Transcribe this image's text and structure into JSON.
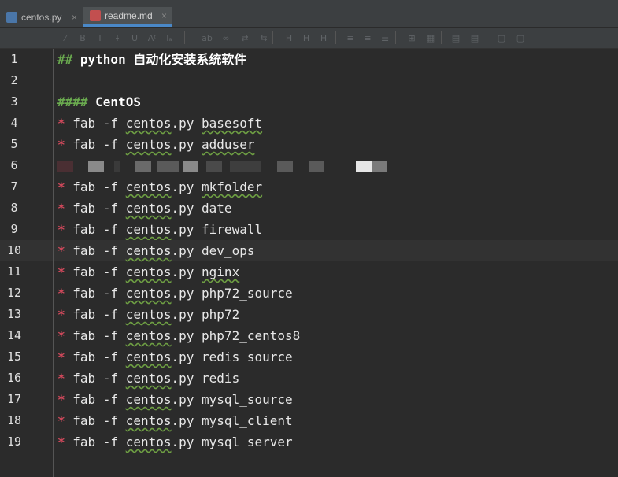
{
  "tabs": [
    {
      "label": "centos.py",
      "close": "×",
      "icon_color": "#4a76a8"
    },
    {
      "label": "readme.md",
      "close": "×",
      "icon_color": "#c24f4f"
    }
  ],
  "toolbar_icons": [
    "format-icon",
    "bold-icon",
    "italic-icon",
    "strikethrough-icon",
    "underline-icon",
    "superscript-icon",
    "subscript-icon",
    "code-icon",
    "link-icon",
    "image-icon",
    "quote-icon",
    "header-icon",
    "header2-icon",
    "header3-icon",
    "align-left-icon",
    "align-center-icon",
    "list-icon",
    "table-icon",
    "grid-icon",
    "preview-icon",
    "split-icon",
    "export-icon",
    "copy-icon"
  ],
  "toolbar_glyphs": [
    "⁄",
    "B",
    "I",
    "Ŧ",
    "U",
    "Aᶦ",
    "Iₐ",
    "ab",
    "∞",
    "⇄",
    "⇆",
    "H",
    "H",
    "H",
    "≡",
    "≡",
    "☰",
    "⊞",
    "▦",
    "▤",
    "▤",
    "▢",
    "▢"
  ],
  "lines": [
    {
      "n": "1",
      "type": "h2",
      "mark": "##",
      "text": " python 自动化安装系统软件"
    },
    {
      "n": "2",
      "type": "blank"
    },
    {
      "n": "3",
      "type": "h4",
      "mark": "####",
      "text": " CentOS"
    },
    {
      "n": "4",
      "type": "cmd",
      "bullet": "*",
      "pre": " fab -f ",
      "file": "centos",
      "post": ".py ",
      "task": "basesoft",
      "task_wavy": true
    },
    {
      "n": "5",
      "type": "cmd",
      "bullet": "*",
      "pre": " fab -f ",
      "file": "centos",
      "post": ".py ",
      "task": "adduser",
      "task_wavy": true
    },
    {
      "n": "6",
      "type": "blurred"
    },
    {
      "n": "7",
      "type": "cmd",
      "bullet": "*",
      "pre": " fab -f ",
      "file": "centos",
      "post": ".py ",
      "task": "mkfolder",
      "task_wavy": true
    },
    {
      "n": "8",
      "type": "cmd",
      "bullet": "*",
      "pre": " fab -f ",
      "file": "centos",
      "post": ".py ",
      "task": "date",
      "task_wavy": false
    },
    {
      "n": "9",
      "type": "cmd",
      "bullet": "*",
      "pre": " fab -f ",
      "file": "centos",
      "post": ".py ",
      "task": "firewall",
      "task_wavy": false
    },
    {
      "n": "10",
      "type": "cmd",
      "bullet": "*",
      "pre": " fab -f ",
      "file": "centos",
      "post": ".py ",
      "task": "dev_ops",
      "task_wavy": false,
      "current": true
    },
    {
      "n": "11",
      "type": "cmd",
      "bullet": "*",
      "pre": " fab -f ",
      "file": "centos",
      "post": ".py ",
      "task": "nginx",
      "task_wavy": true
    },
    {
      "n": "12",
      "type": "cmd",
      "bullet": "*",
      "pre": " fab -f ",
      "file": "centos",
      "post": ".py ",
      "task": "php72_source",
      "task_wavy": false
    },
    {
      "n": "13",
      "type": "cmd",
      "bullet": "*",
      "pre": " fab -f ",
      "file": "centos",
      "post": ".py ",
      "task": "php72",
      "task_wavy": false
    },
    {
      "n": "14",
      "type": "cmd",
      "bullet": "*",
      "pre": " fab -f ",
      "file": "centos",
      "post": ".py ",
      "task": "php72_centos8",
      "task_wavy": false
    },
    {
      "n": "15",
      "type": "cmd",
      "bullet": "*",
      "pre": " fab -f ",
      "file": "centos",
      "post": ".py ",
      "task": "redis_source",
      "task_wavy": false
    },
    {
      "n": "16",
      "type": "cmd",
      "bullet": "*",
      "pre": " fab -f ",
      "file": "centos",
      "post": ".py ",
      "task": "redis",
      "task_wavy": false
    },
    {
      "n": "17",
      "type": "cmd",
      "bullet": "*",
      "pre": " fab -f ",
      "file": "centos",
      "post": ".py ",
      "task": "mysql_source",
      "task_wavy": false
    },
    {
      "n": "18",
      "type": "cmd",
      "bullet": "*",
      "pre": " fab -f ",
      "file": "centos",
      "post": ".py ",
      "task": "mysql_client",
      "task_wavy": false
    },
    {
      "n": "19",
      "type": "cmd",
      "bullet": "*",
      "pre": " fab -f ",
      "file": "centos",
      "post": ".py ",
      "task": "mysql_server",
      "task_wavy": false
    }
  ],
  "colors": {
    "background": "#2b2b2b",
    "bullet": "#d2495c",
    "header_mark": "#6aaa4f",
    "spell_wave": "#6e9f43",
    "current_line": "#323232"
  }
}
